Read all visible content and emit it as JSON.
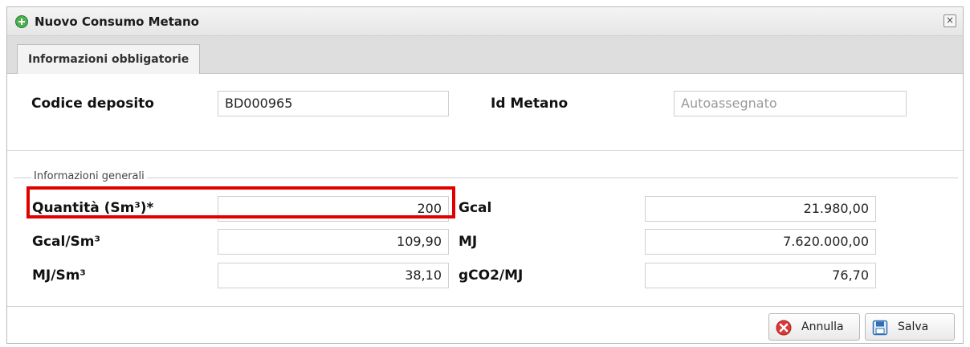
{
  "window": {
    "title": "Nuovo Consumo Metano",
    "close_icon": "close-icon"
  },
  "tabs": [
    {
      "label": "Informazioni obbligatorie",
      "active": true
    }
  ],
  "top_section": {
    "codice_deposito": {
      "label": "Codice deposito",
      "value": "BD000965"
    },
    "id_metano": {
      "label": "Id Metano",
      "placeholder": "Autoassegnato"
    }
  },
  "general_section": {
    "legend": "Informazioni generali",
    "fields": {
      "quantita": {
        "label": "Quantità (Sm³)*",
        "value": "200"
      },
      "gcal": {
        "label": "Gcal",
        "value": "21.980,00"
      },
      "gcal_sm3": {
        "label": "Gcal/Sm³",
        "value": "109,90"
      },
      "mj": {
        "label": "MJ",
        "value": "7.620.000,00"
      },
      "mj_sm3": {
        "label": "MJ/Sm³",
        "value": "38,10"
      },
      "gco2_mj": {
        "label": "gCO2/MJ",
        "value": "76,70"
      }
    }
  },
  "footer": {
    "cancel_label": "Annulla",
    "save_label": "Salva"
  },
  "colors": {
    "highlight": "#e00000",
    "cancel_icon": "#d83a3a",
    "save_icon": "#2f6fb3",
    "title_icon": "#4caf50"
  }
}
